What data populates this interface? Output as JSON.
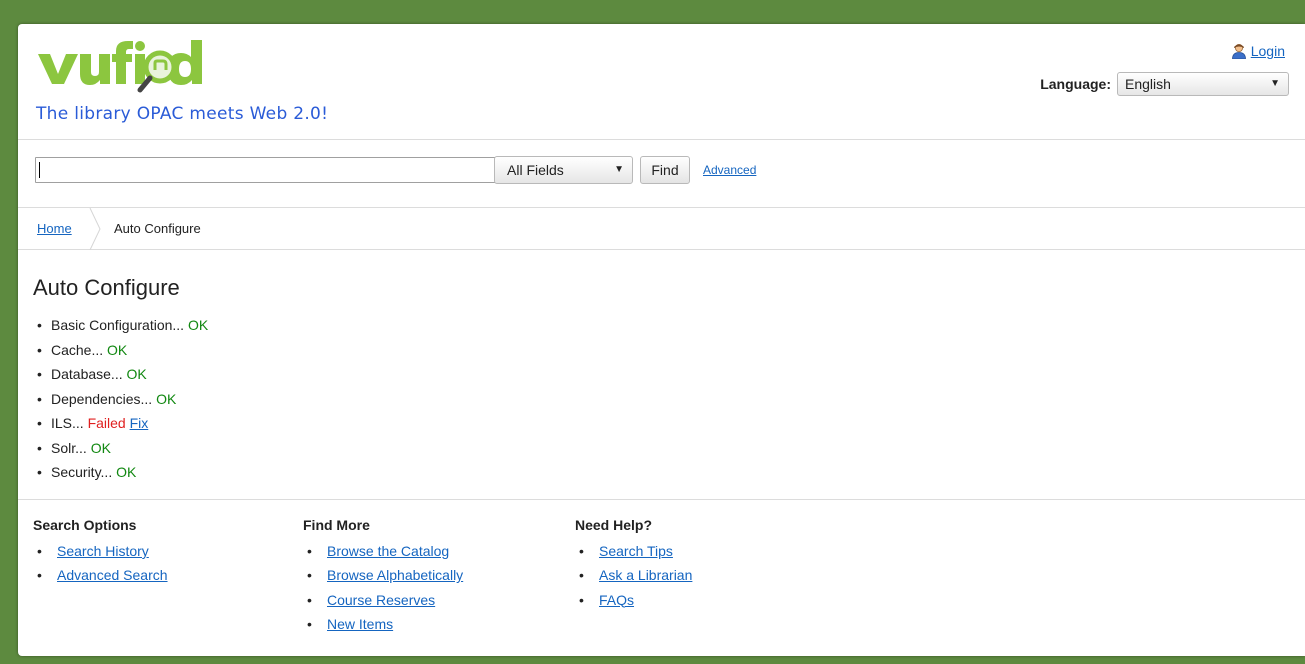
{
  "header": {
    "logo_text": "vufind",
    "tagline": "The library OPAC meets Web 2.0!",
    "login_label": "Login",
    "language_label": "Language:",
    "language_value": "English"
  },
  "search": {
    "query": "",
    "type_value": "All Fields",
    "find_label": "Find",
    "advanced_label": "Advanced"
  },
  "breadcrumb": {
    "home": "Home",
    "current": "Auto Configure"
  },
  "main": {
    "title": "Auto Configure",
    "checks": [
      {
        "label": "Basic Configuration...",
        "status": "OK"
      },
      {
        "label": "Cache...",
        "status": "OK"
      },
      {
        "label": "Database...",
        "status": "OK"
      },
      {
        "label": "Dependencies...",
        "status": "OK"
      },
      {
        "label": "ILS...",
        "status": "Failed",
        "fix": "Fix"
      },
      {
        "label": "Solr...",
        "status": "OK"
      },
      {
        "label": "Security...",
        "status": "OK"
      }
    ]
  },
  "footer": {
    "columns": [
      {
        "title": "Search Options",
        "links": [
          "Search History",
          "Advanced Search"
        ]
      },
      {
        "title": "Find More",
        "links": [
          "Browse the Catalog",
          "Browse Alphabetically",
          "Course Reserves",
          "New Items"
        ]
      },
      {
        "title": "Need Help?",
        "links": [
          "Search Tips",
          "Ask a Librarian",
          "FAQs"
        ]
      }
    ]
  },
  "colors": {
    "background": "#5d8a3f",
    "link": "#1565c0",
    "ok": "#118811",
    "failed": "#e02020",
    "tagline": "#2a5bd7",
    "logo_green": "#8cc63f"
  }
}
